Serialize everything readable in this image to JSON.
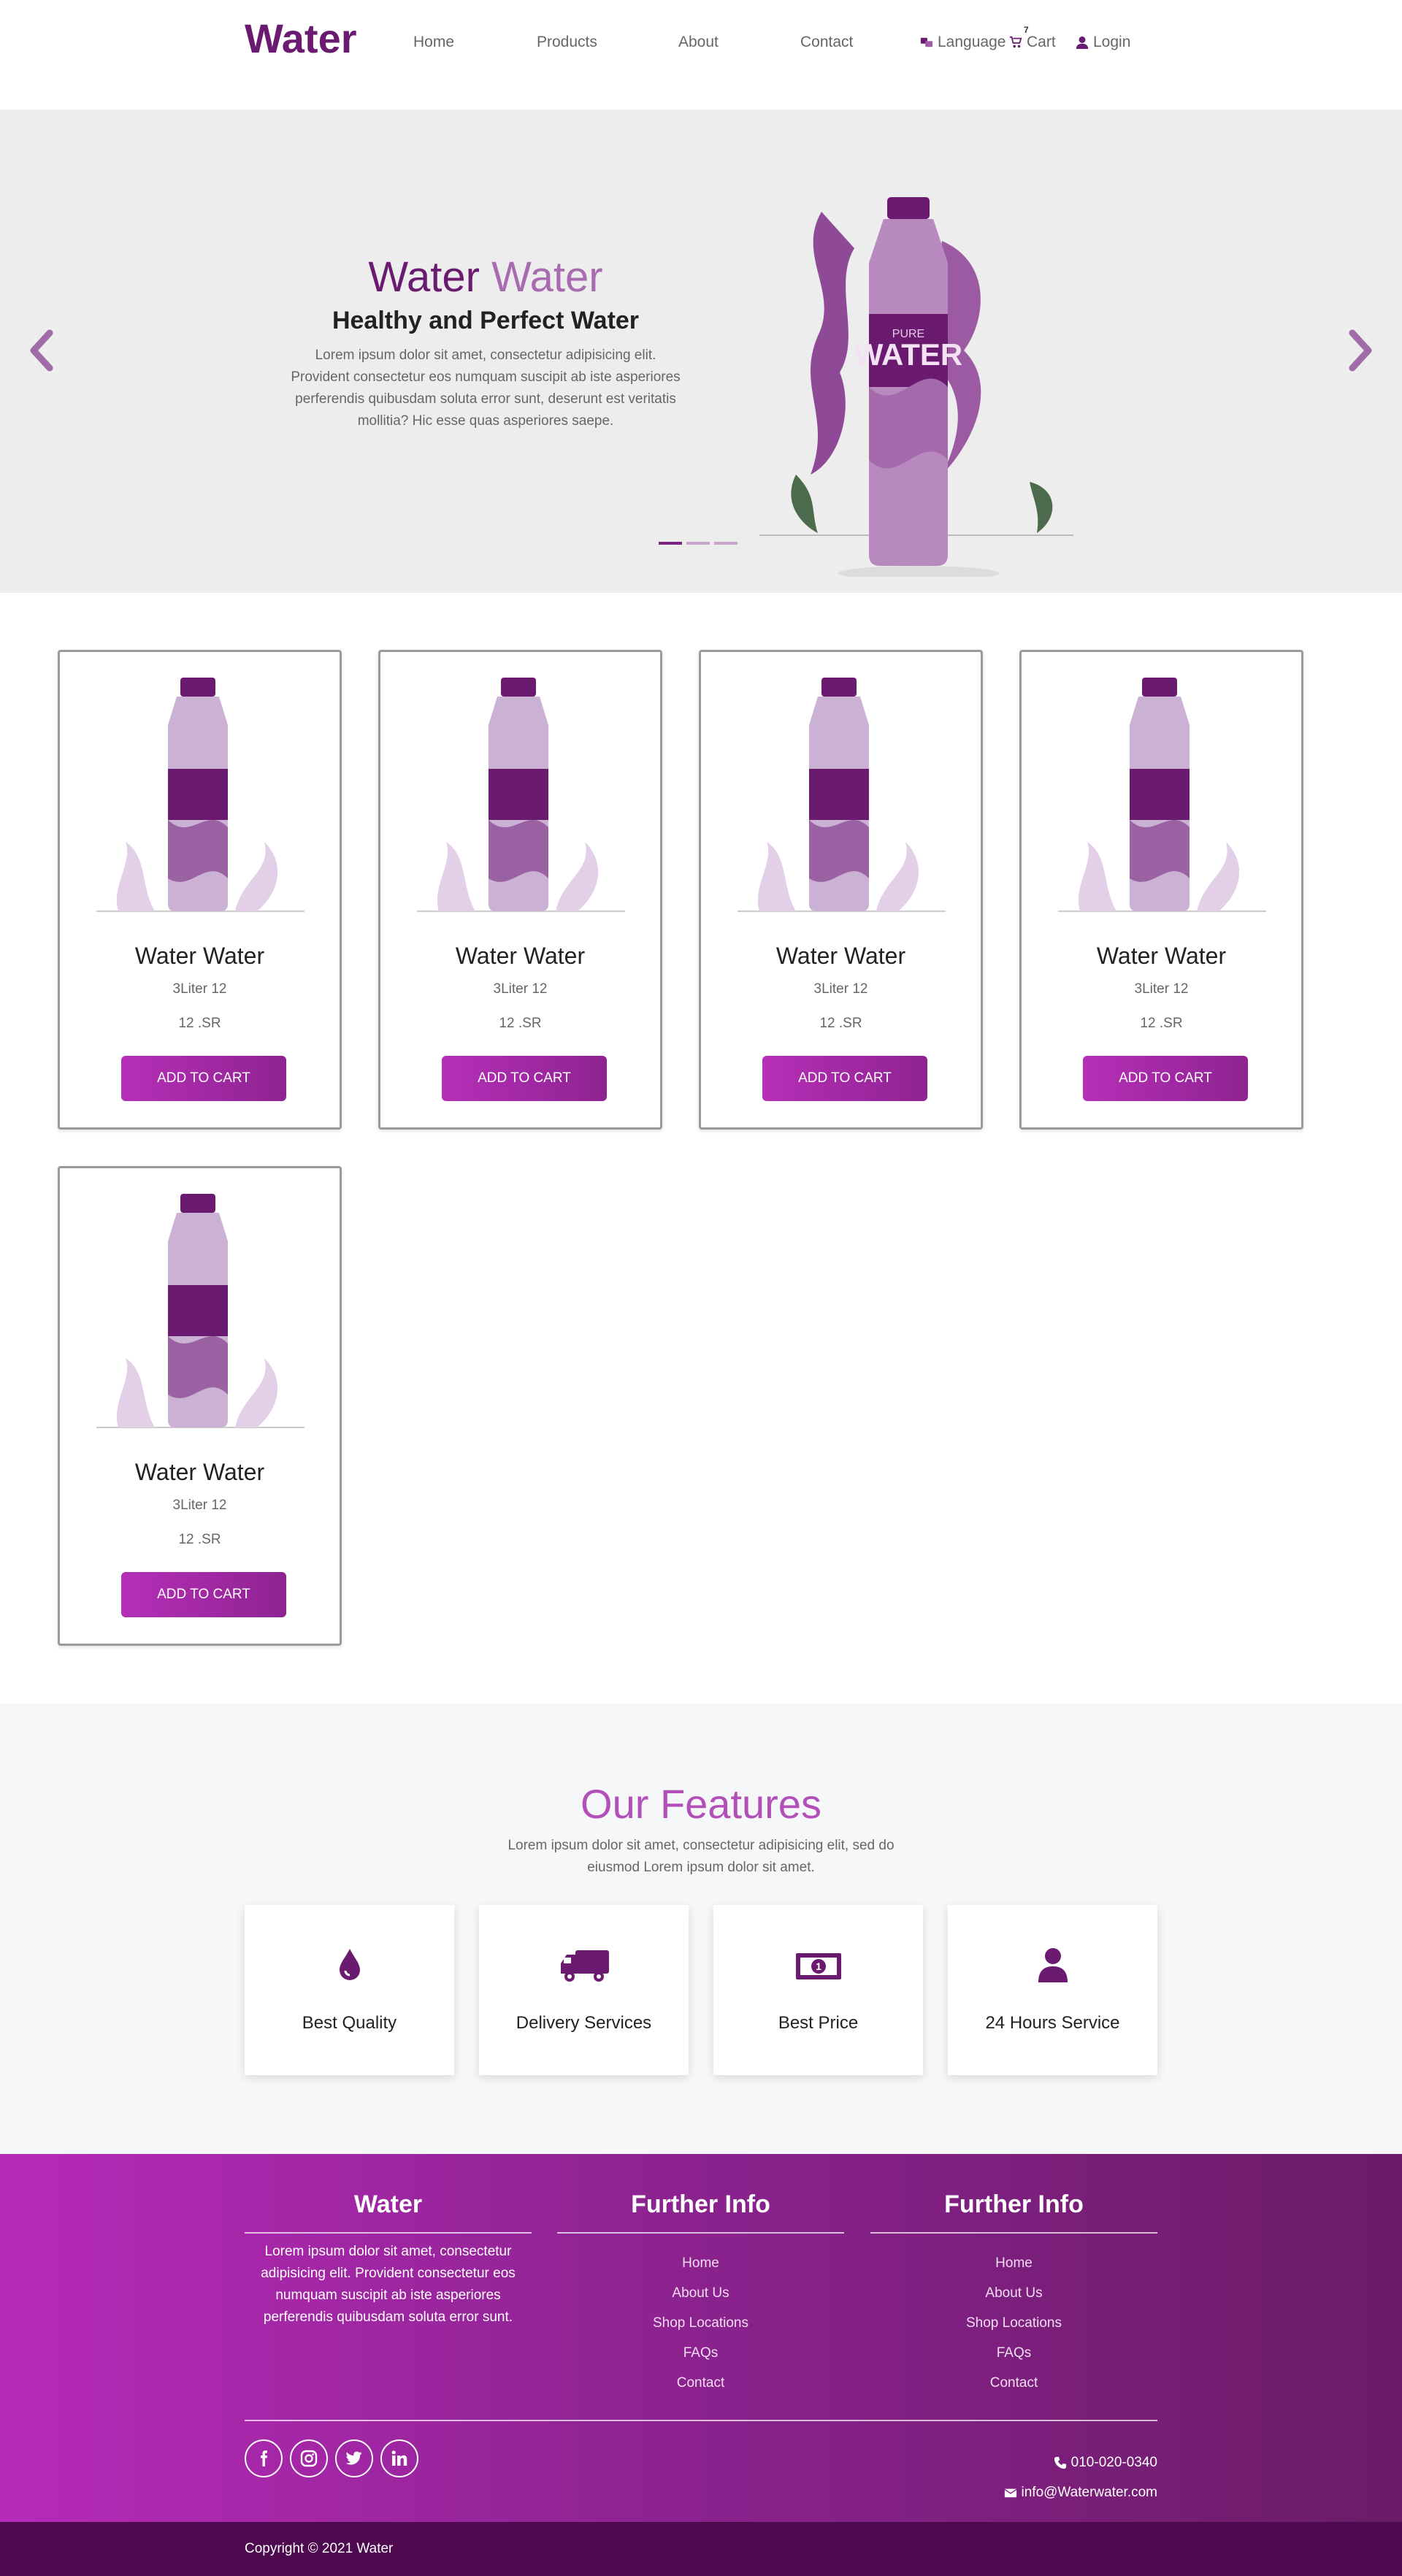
{
  "nav": {
    "brand": "Water",
    "links": [
      "Home",
      "Products",
      "About",
      "Contact"
    ],
    "language": "Language",
    "cart": "Cart",
    "cart_count": "7",
    "login": "Login"
  },
  "hero": {
    "title_1": "Water",
    "title_2": "Water",
    "subtitle": "Healthy and Perfect Water",
    "text": "Lorem ipsum dolor sit amet, consectetur adipisicing elit. Provident consectetur eos numquam suscipit ab iste asperiores perferendis quibusdam soluta error sunt, deserunt est veritatis mollitia? Hic esse quas asperiores saepe.",
    "bottle_label_top": "PURE",
    "bottle_label_main": "WATER",
    "slides": 3,
    "active_slide": 1
  },
  "products": [
    {
      "name": "Water Water",
      "size": "3Liter 12",
      "price": "12 .SR",
      "button": "ADD TO CART"
    },
    {
      "name": "Water Water",
      "size": "3Liter 12",
      "price": "12 .SR",
      "button": "ADD TO CART"
    },
    {
      "name": "Water Water",
      "size": "3Liter 12",
      "price": "12 .SR",
      "button": "ADD TO CART"
    },
    {
      "name": "Water Water",
      "size": "3Liter 12",
      "price": "12 .SR",
      "button": "ADD TO CART"
    },
    {
      "name": "Water Water",
      "size": "3Liter 12",
      "price": "12 .SR",
      "button": "ADD TO CART"
    }
  ],
  "features": {
    "title": "Our Features",
    "text": "Lorem ipsum dolor sit amet, consectetur adipisicing elit, sed do eiusmod Lorem ipsum dolor sit amet.",
    "items": [
      {
        "label": "Best Quality",
        "icon": "droplet-icon"
      },
      {
        "label": "Delivery Services",
        "icon": "truck-icon"
      },
      {
        "label": "Best Price",
        "icon": "money-bill-icon"
      },
      {
        "label": "24 Hours Service",
        "icon": "user-icon"
      }
    ]
  },
  "footer": {
    "col1": {
      "title": "Water",
      "text": "Lorem ipsum dolor sit amet, consectetur adipisicing elit. Provident consectetur eos numquam suscipit ab iste asperiores perferendis quibusdam soluta error sunt."
    },
    "col2": {
      "title": "Further Info",
      "links": [
        "Home",
        "About Us",
        "Shop Locations",
        "FAQs",
        "Contact"
      ]
    },
    "col3": {
      "title": "Further Info",
      "links": [
        "Home",
        "About Us",
        "Shop Locations",
        "FAQs",
        "Contact"
      ]
    },
    "socials": [
      "facebook-icon",
      "instagram-icon",
      "twitter-icon",
      "linkedin-icon"
    ],
    "phone": "010-020-0340",
    "email": "info@Waterwater.com",
    "copyright": "Copyright © 2021 Water"
  },
  "colors": {
    "brand": "#6b1b6f",
    "accent": "#b62fb8",
    "footer_dark": "#4e0a4e"
  }
}
